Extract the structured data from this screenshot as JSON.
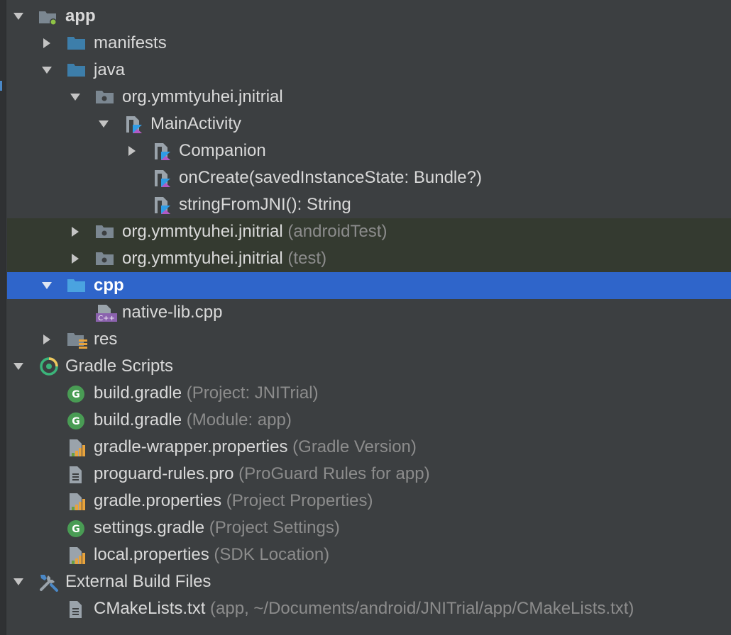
{
  "tree": {
    "app": {
      "label": "app"
    },
    "manifests": {
      "label": "manifests"
    },
    "java": {
      "label": "java"
    },
    "pkg_main": {
      "label": "org.ymmtyuhei.jnitrial"
    },
    "main_activity": {
      "label": "MainActivity"
    },
    "companion": {
      "label": "Companion"
    },
    "on_create": {
      "label": "onCreate(savedInstanceState: Bundle?)"
    },
    "string_from_jni": {
      "label": "stringFromJNI(): String"
    },
    "pkg_android_test": {
      "label": "org.ymmtyuhei.jnitrial",
      "suffix": "(androidTest)"
    },
    "pkg_test": {
      "label": "org.ymmtyuhei.jnitrial",
      "suffix": "(test)"
    },
    "cpp": {
      "label": "cpp"
    },
    "native_lib": {
      "label": "native-lib.cpp",
      "badge": "C++"
    },
    "res": {
      "label": "res"
    },
    "gradle_scripts": {
      "label": "Gradle Scripts"
    },
    "build_gradle_project": {
      "label": "build.gradle",
      "suffix": "(Project: JNITrial)",
      "badge": "G"
    },
    "build_gradle_module": {
      "label": "build.gradle",
      "suffix": "(Module: app)",
      "badge": "G"
    },
    "gradle_wrapper": {
      "label": "gradle-wrapper.properties",
      "suffix": "(Gradle Version)"
    },
    "proguard": {
      "label": "proguard-rules.pro",
      "suffix": "(ProGuard Rules for app)"
    },
    "gradle_properties": {
      "label": "gradle.properties",
      "suffix": "(Project Properties)"
    },
    "settings_gradle": {
      "label": "settings.gradle",
      "suffix": "(Project Settings)",
      "badge": "G"
    },
    "local_properties": {
      "label": "local.properties",
      "suffix": "(SDK Location)"
    },
    "external_build": {
      "label": "External Build Files"
    },
    "cmakelists": {
      "label": "CMakeLists.txt",
      "suffix": "(app, ~/Documents/android/JNITrial/app/CMakeLists.txt)"
    }
  },
  "icons": {
    "folder": "folder-icon",
    "package": "package-icon",
    "kotlin_class": "kotlin-class-icon",
    "cpp_file": "cpp-file-icon",
    "gradle": "gradle-icon",
    "properties": "properties-file-icon",
    "text_file": "text-file-icon",
    "gradle_scripts": "gradle-scripts-icon",
    "tools": "tools-icon"
  },
  "colors": {
    "background": "#3c3f41",
    "selection": "#2f65ca",
    "test_tint": "#343a30",
    "folder": "#3d7eaa",
    "gradle_green": "#499c54",
    "text": "#d9d9d9",
    "muted": "#8c8c8c"
  }
}
